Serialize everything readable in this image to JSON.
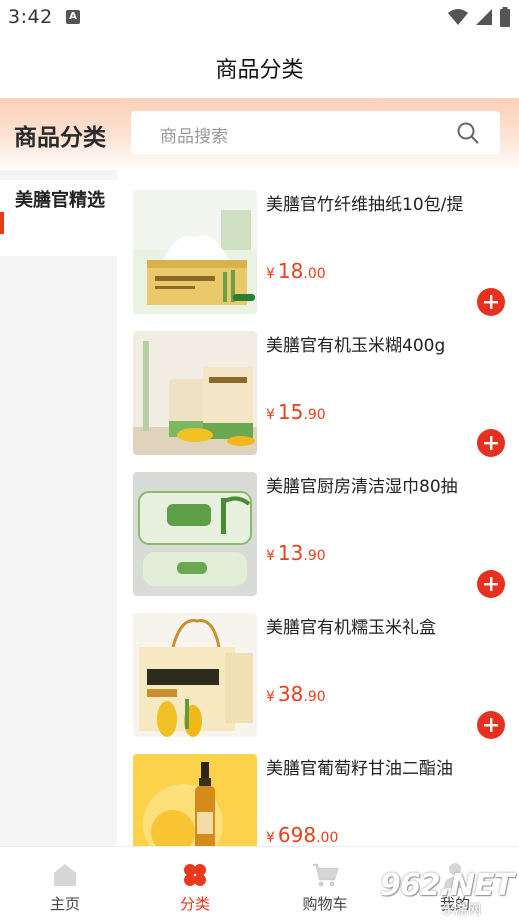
{
  "status_bar": {
    "time": "3:42",
    "notification_letter": "A"
  },
  "title_bar": {
    "title": "商品分类"
  },
  "header": {
    "title": "商品分类",
    "search_placeholder": "商品搜索"
  },
  "sidebar": {
    "items": [
      {
        "label": "美膳官精选",
        "active": true
      }
    ]
  },
  "products": [
    {
      "name": "美膳官竹纤维抽纸10包/提",
      "currency": "¥",
      "price_int": "18",
      "price_dec": ".00"
    },
    {
      "name": "美膳官有机玉米糊400g",
      "currency": "¥",
      "price_int": "15",
      "price_dec": ".90"
    },
    {
      "name": "美膳官厨房清洁湿巾80抽",
      "currency": "¥",
      "price_int": "13",
      "price_dec": ".90"
    },
    {
      "name": "美膳官有机糯玉米礼盒",
      "currency": "¥",
      "price_int": "38",
      "price_dec": ".90"
    },
    {
      "name": "美膳官葡萄籽甘油二酯油",
      "currency": "¥",
      "price_int": "698",
      "price_dec": ".00"
    }
  ],
  "bottom_nav": [
    {
      "label": "主页",
      "icon": "home-icon",
      "active": false
    },
    {
      "label": "分类",
      "icon": "category-icon",
      "active": true
    },
    {
      "label": "购物车",
      "icon": "cart-icon",
      "active": false
    },
    {
      "label": "我的",
      "icon": "user-icon",
      "active": false
    }
  ],
  "watermark": {
    "big": "962.NET",
    "small": "乐游网"
  },
  "colors": {
    "accent": "#e8391f",
    "price": "#e8401c",
    "add_button": "#e63120",
    "header_gradient_top": "#fcd0b8"
  }
}
